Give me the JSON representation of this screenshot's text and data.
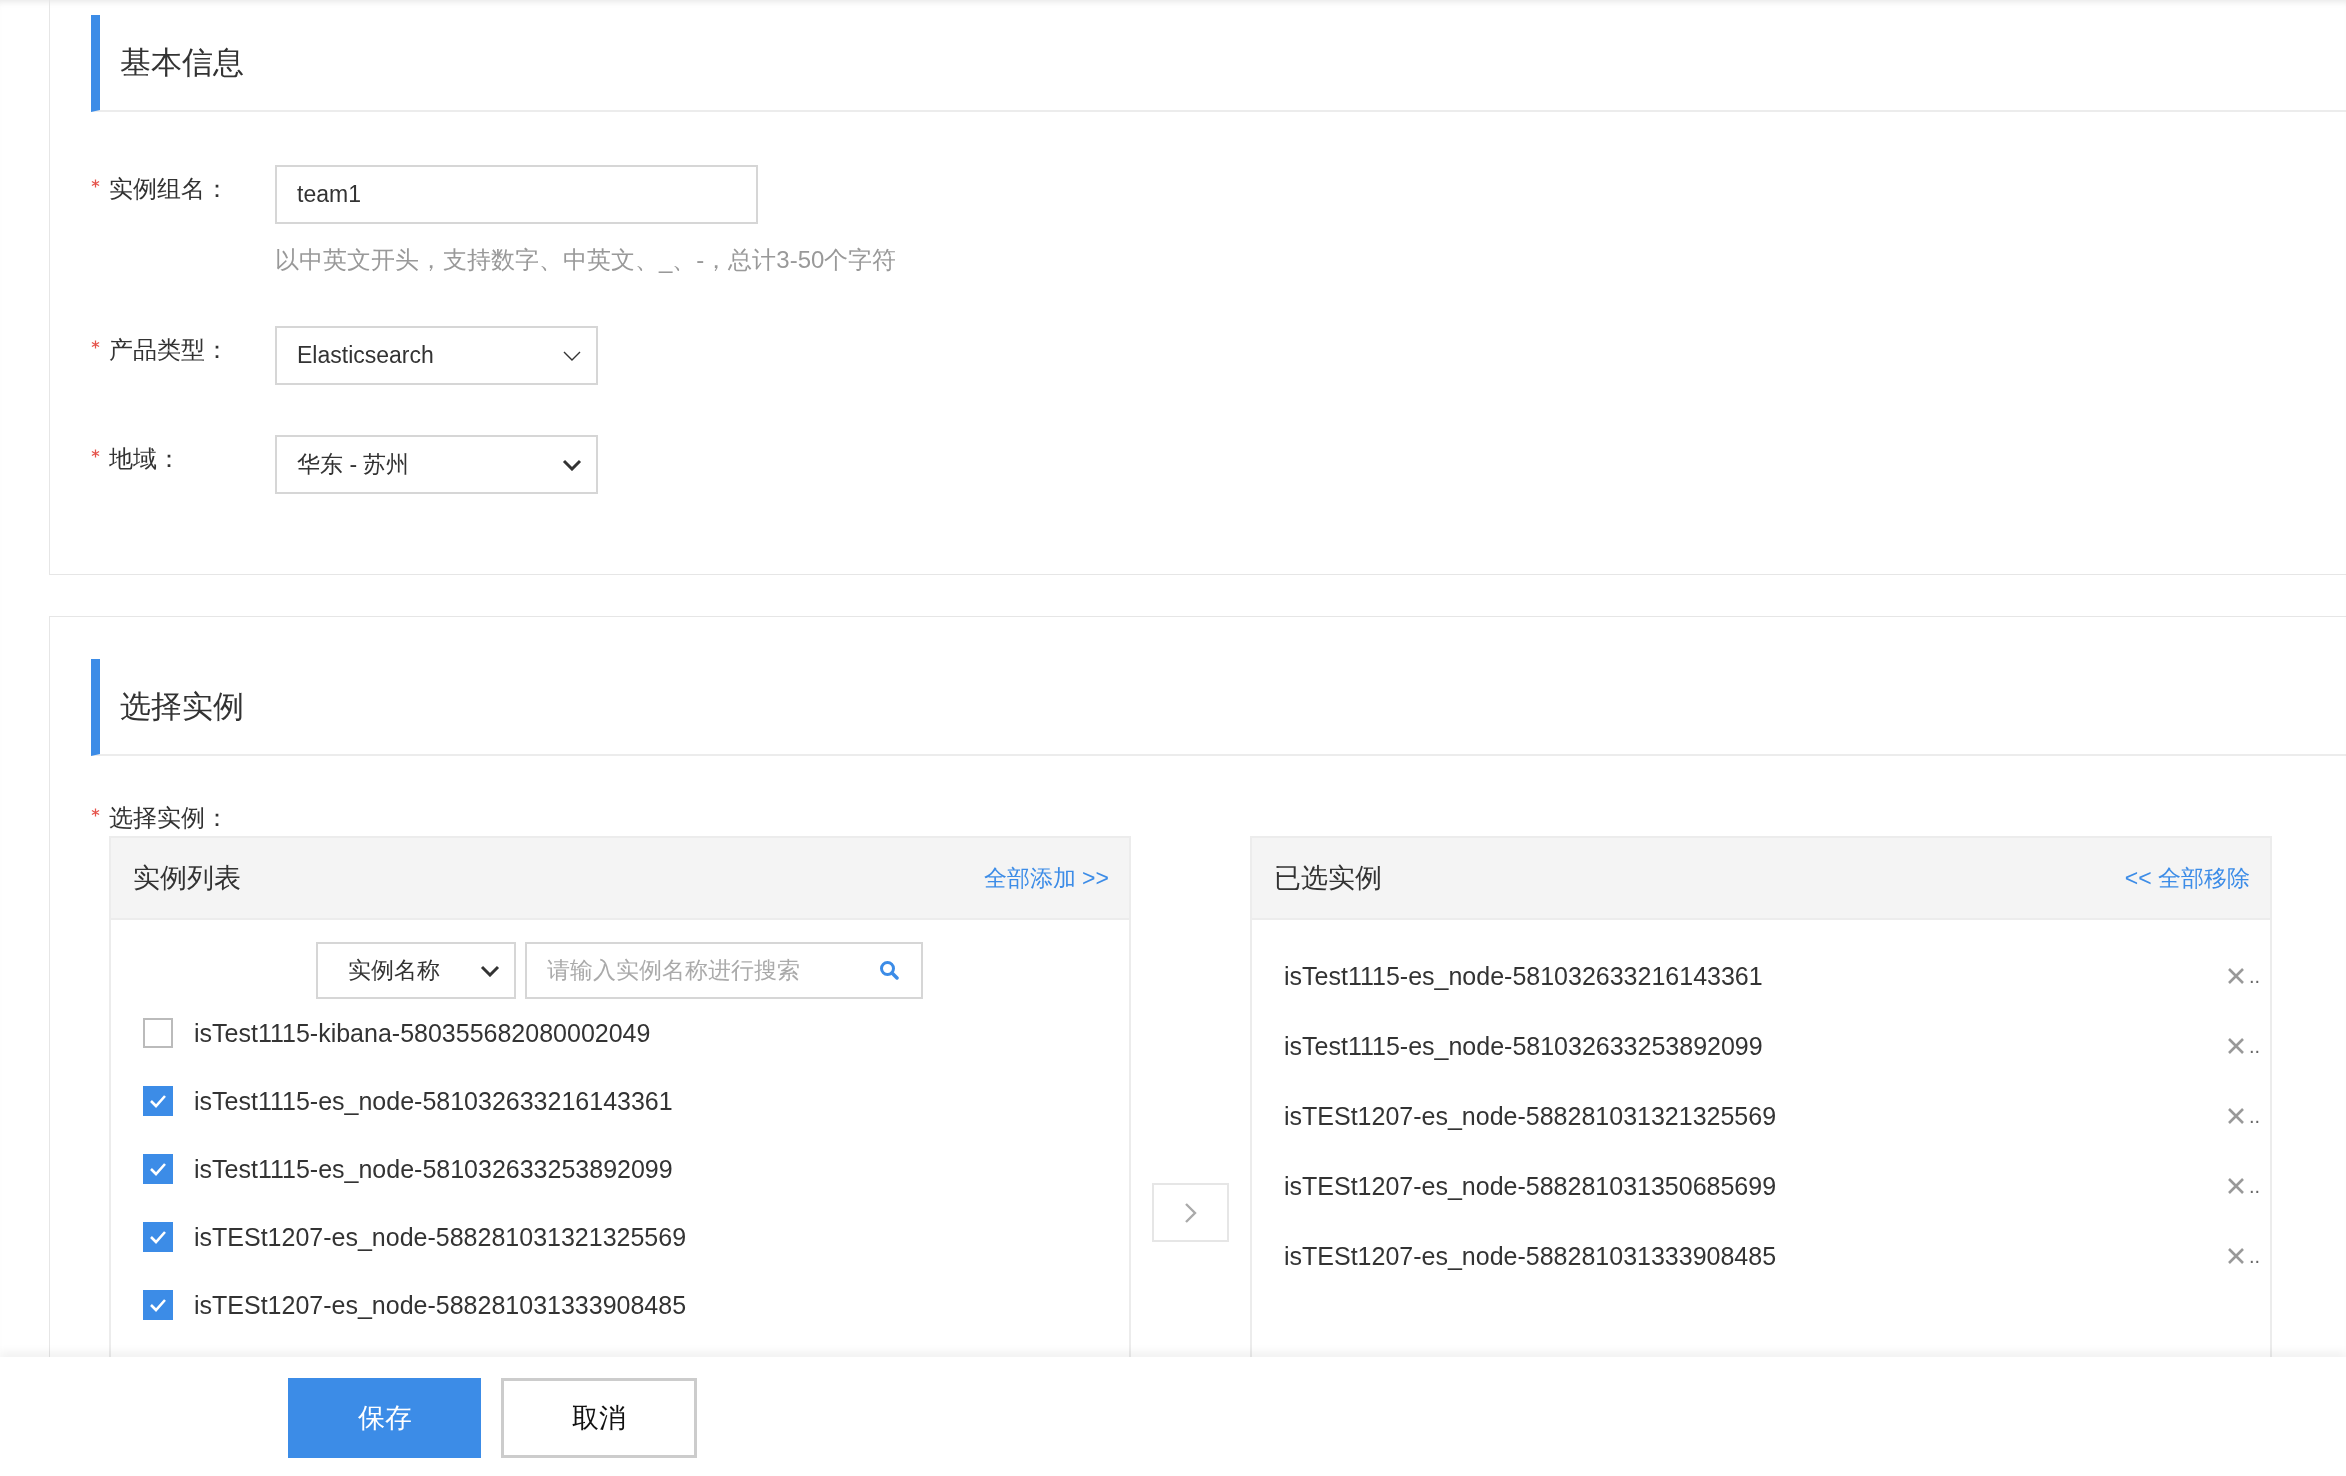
{
  "basic_info": {
    "title": "基本信息",
    "fields": [
      {
        "kind": "text",
        "label": "实例组名：",
        "required": true,
        "value": "team1",
        "hint": "以中英文开头，支持数字、中英文、_、-，总计3-50个字符"
      },
      {
        "kind": "select",
        "label": "产品类型：",
        "required": true,
        "value": "Elasticsearch"
      },
      {
        "kind": "dropdown",
        "label": "地域：",
        "required": true,
        "value": "华东 - 苏州"
      }
    ]
  },
  "select_instances": {
    "title": "选择实例",
    "label": "选择实例：",
    "required": true,
    "source": {
      "title": "实例列表",
      "add_all": "全部添加 >>",
      "filter": "实例名称",
      "search_placeholder": "请输入实例名称进行搜索",
      "items": [
        {
          "name": "isTest1115-kibana-580355682080002049",
          "checked": false
        },
        {
          "name": "isTest1115-es_node-581032633216143361",
          "checked": true
        },
        {
          "name": "isTest1115-es_node-581032633253892099",
          "checked": true
        },
        {
          "name": "isTESt1207-es_node-588281031321325569",
          "checked": true
        },
        {
          "name": "isTESt1207-es_node-588281031333908485",
          "checked": true
        }
      ]
    },
    "target": {
      "title": "已选实例",
      "remove_all": "<< 全部移除",
      "items": [
        {
          "name": "isTest1115-es_node-581032633216143361",
          "suffix": ".."
        },
        {
          "name": "isTest1115-es_node-581032633253892099",
          "suffix": ".."
        },
        {
          "name": "isTESt1207-es_node-588281031321325569",
          "suffix": ".."
        },
        {
          "name": "isTESt1207-es_node-588281031350685699",
          "suffix": ".."
        },
        {
          "name": "isTESt1207-es_node-588281031333908485",
          "suffix": ".."
        }
      ]
    }
  },
  "actions": {
    "save": "保存",
    "cancel": "取消"
  }
}
